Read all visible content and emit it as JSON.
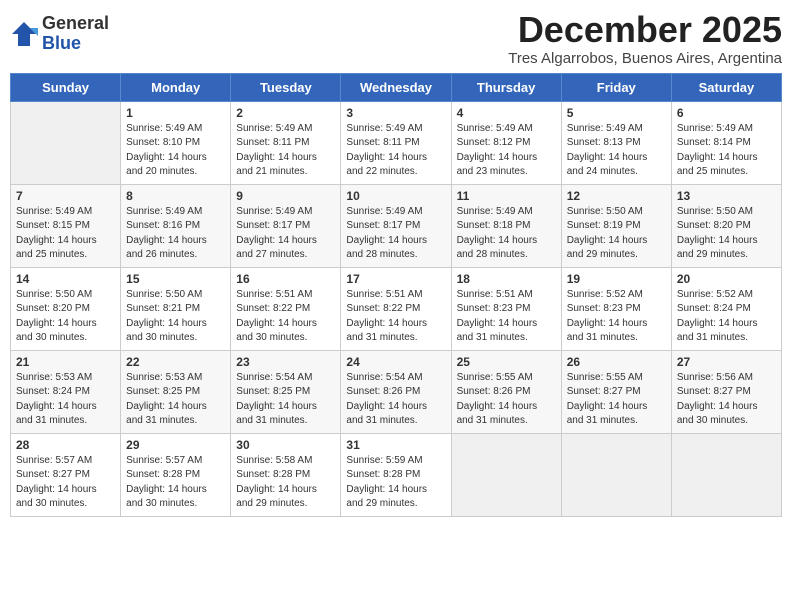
{
  "logo": {
    "general": "General",
    "blue": "Blue"
  },
  "title": "December 2025",
  "location": "Tres Algarrobos, Buenos Aires, Argentina",
  "weekdays": [
    "Sunday",
    "Monday",
    "Tuesday",
    "Wednesday",
    "Thursday",
    "Friday",
    "Saturday"
  ],
  "weeks": [
    [
      {
        "day": null
      },
      {
        "day": "1",
        "sunrise": "Sunrise: 5:49 AM",
        "sunset": "Sunset: 8:10 PM",
        "daylight": "Daylight: 14 hours and 20 minutes."
      },
      {
        "day": "2",
        "sunrise": "Sunrise: 5:49 AM",
        "sunset": "Sunset: 8:11 PM",
        "daylight": "Daylight: 14 hours and 21 minutes."
      },
      {
        "day": "3",
        "sunrise": "Sunrise: 5:49 AM",
        "sunset": "Sunset: 8:11 PM",
        "daylight": "Daylight: 14 hours and 22 minutes."
      },
      {
        "day": "4",
        "sunrise": "Sunrise: 5:49 AM",
        "sunset": "Sunset: 8:12 PM",
        "daylight": "Daylight: 14 hours and 23 minutes."
      },
      {
        "day": "5",
        "sunrise": "Sunrise: 5:49 AM",
        "sunset": "Sunset: 8:13 PM",
        "daylight": "Daylight: 14 hours and 24 minutes."
      },
      {
        "day": "6",
        "sunrise": "Sunrise: 5:49 AM",
        "sunset": "Sunset: 8:14 PM",
        "daylight": "Daylight: 14 hours and 25 minutes."
      }
    ],
    [
      {
        "day": "7",
        "sunrise": "Sunrise: 5:49 AM",
        "sunset": "Sunset: 8:15 PM",
        "daylight": "Daylight: 14 hours and 25 minutes."
      },
      {
        "day": "8",
        "sunrise": "Sunrise: 5:49 AM",
        "sunset": "Sunset: 8:16 PM",
        "daylight": "Daylight: 14 hours and 26 minutes."
      },
      {
        "day": "9",
        "sunrise": "Sunrise: 5:49 AM",
        "sunset": "Sunset: 8:17 PM",
        "daylight": "Daylight: 14 hours and 27 minutes."
      },
      {
        "day": "10",
        "sunrise": "Sunrise: 5:49 AM",
        "sunset": "Sunset: 8:17 PM",
        "daylight": "Daylight: 14 hours and 28 minutes."
      },
      {
        "day": "11",
        "sunrise": "Sunrise: 5:49 AM",
        "sunset": "Sunset: 8:18 PM",
        "daylight": "Daylight: 14 hours and 28 minutes."
      },
      {
        "day": "12",
        "sunrise": "Sunrise: 5:50 AM",
        "sunset": "Sunset: 8:19 PM",
        "daylight": "Daylight: 14 hours and 29 minutes."
      },
      {
        "day": "13",
        "sunrise": "Sunrise: 5:50 AM",
        "sunset": "Sunset: 8:20 PM",
        "daylight": "Daylight: 14 hours and 29 minutes."
      }
    ],
    [
      {
        "day": "14",
        "sunrise": "Sunrise: 5:50 AM",
        "sunset": "Sunset: 8:20 PM",
        "daylight": "Daylight: 14 hours and 30 minutes."
      },
      {
        "day": "15",
        "sunrise": "Sunrise: 5:50 AM",
        "sunset": "Sunset: 8:21 PM",
        "daylight": "Daylight: 14 hours and 30 minutes."
      },
      {
        "day": "16",
        "sunrise": "Sunrise: 5:51 AM",
        "sunset": "Sunset: 8:22 PM",
        "daylight": "Daylight: 14 hours and 30 minutes."
      },
      {
        "day": "17",
        "sunrise": "Sunrise: 5:51 AM",
        "sunset": "Sunset: 8:22 PM",
        "daylight": "Daylight: 14 hours and 31 minutes."
      },
      {
        "day": "18",
        "sunrise": "Sunrise: 5:51 AM",
        "sunset": "Sunset: 8:23 PM",
        "daylight": "Daylight: 14 hours and 31 minutes."
      },
      {
        "day": "19",
        "sunrise": "Sunrise: 5:52 AM",
        "sunset": "Sunset: 8:23 PM",
        "daylight": "Daylight: 14 hours and 31 minutes."
      },
      {
        "day": "20",
        "sunrise": "Sunrise: 5:52 AM",
        "sunset": "Sunset: 8:24 PM",
        "daylight": "Daylight: 14 hours and 31 minutes."
      }
    ],
    [
      {
        "day": "21",
        "sunrise": "Sunrise: 5:53 AM",
        "sunset": "Sunset: 8:24 PM",
        "daylight": "Daylight: 14 hours and 31 minutes."
      },
      {
        "day": "22",
        "sunrise": "Sunrise: 5:53 AM",
        "sunset": "Sunset: 8:25 PM",
        "daylight": "Daylight: 14 hours and 31 minutes."
      },
      {
        "day": "23",
        "sunrise": "Sunrise: 5:54 AM",
        "sunset": "Sunset: 8:25 PM",
        "daylight": "Daylight: 14 hours and 31 minutes."
      },
      {
        "day": "24",
        "sunrise": "Sunrise: 5:54 AM",
        "sunset": "Sunset: 8:26 PM",
        "daylight": "Daylight: 14 hours and 31 minutes."
      },
      {
        "day": "25",
        "sunrise": "Sunrise: 5:55 AM",
        "sunset": "Sunset: 8:26 PM",
        "daylight": "Daylight: 14 hours and 31 minutes."
      },
      {
        "day": "26",
        "sunrise": "Sunrise: 5:55 AM",
        "sunset": "Sunset: 8:27 PM",
        "daylight": "Daylight: 14 hours and 31 minutes."
      },
      {
        "day": "27",
        "sunrise": "Sunrise: 5:56 AM",
        "sunset": "Sunset: 8:27 PM",
        "daylight": "Daylight: 14 hours and 30 minutes."
      }
    ],
    [
      {
        "day": "28",
        "sunrise": "Sunrise: 5:57 AM",
        "sunset": "Sunset: 8:27 PM",
        "daylight": "Daylight: 14 hours and 30 minutes."
      },
      {
        "day": "29",
        "sunrise": "Sunrise: 5:57 AM",
        "sunset": "Sunset: 8:28 PM",
        "daylight": "Daylight: 14 hours and 30 minutes."
      },
      {
        "day": "30",
        "sunrise": "Sunrise: 5:58 AM",
        "sunset": "Sunset: 8:28 PM",
        "daylight": "Daylight: 14 hours and 29 minutes."
      },
      {
        "day": "31",
        "sunrise": "Sunrise: 5:59 AM",
        "sunset": "Sunset: 8:28 PM",
        "daylight": "Daylight: 14 hours and 29 minutes."
      },
      {
        "day": null
      },
      {
        "day": null
      },
      {
        "day": null
      }
    ]
  ]
}
